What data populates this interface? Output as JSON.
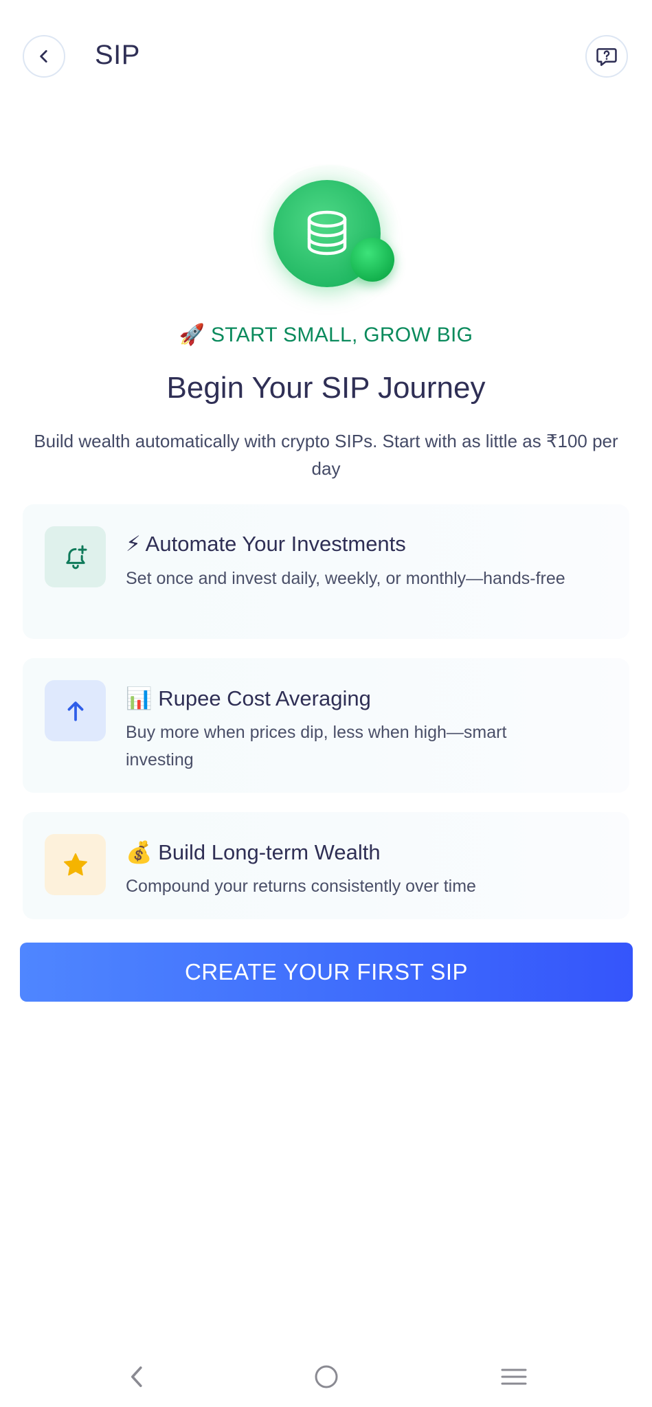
{
  "header": {
    "title": "SIP",
    "back_icon": "chevron-left-icon",
    "help_icon": "help-chat-icon"
  },
  "hero": {
    "icon": "coins-stack-icon",
    "tagline": "🚀 START SMALL, GROW BIG",
    "heading": "Begin Your SIP Journey",
    "subtitle": "Build wealth automatically with crypto SIPs. Start with as little as ₹100 per day"
  },
  "features": [
    {
      "icon": "bell-plus-icon",
      "title": "⚡ Automate Your Investments",
      "description": "Set once and invest daily, weekly, or monthly—hands-free",
      "icon_color": "#0f7a5a"
    },
    {
      "icon": "arrow-up-icon",
      "title": "📊 Rupee Cost Averaging",
      "description": "Buy more when prices dip, less when high—smart investing",
      "icon_color": "#2f5ee8"
    },
    {
      "icon": "star-icon",
      "title": "💰 Build Long-term Wealth",
      "description": "Compound your returns consistently over time",
      "icon_color": "#f5b400"
    }
  ],
  "cta": {
    "label": "CREATE YOUR FIRST SIP"
  },
  "colors": {
    "accent_green": "#0a8a5c",
    "cta_start": "#4f86ff",
    "cta_end": "#3555fb",
    "text_dark": "#2f2f55"
  },
  "navbar": {
    "back_icon": "nav-back-icon",
    "home_icon": "nav-home-icon",
    "menu_icon": "nav-menu-icon"
  }
}
